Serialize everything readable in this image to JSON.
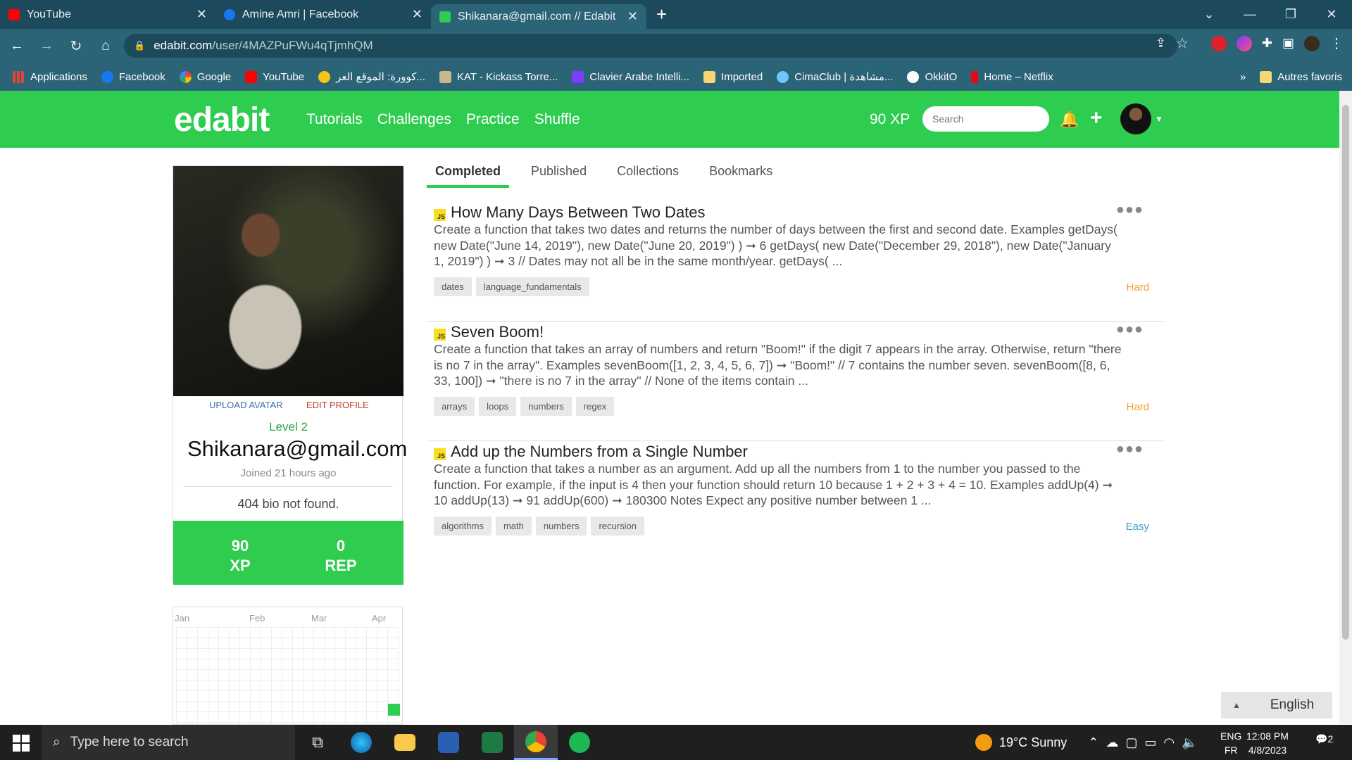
{
  "browser": {
    "tabs": [
      {
        "title": "YouTube",
        "icon": "youtube-icon",
        "color": "#ff0000"
      },
      {
        "title": "Amine Amri | Facebook",
        "icon": "facebook-icon",
        "color": "#1877f2"
      },
      {
        "title": "Shikanara@gmail.com // Edabit",
        "icon": "edabit-icon",
        "color": "#2ecc4f"
      }
    ],
    "url_host": "edabit.com",
    "url_path": "/user/4MAZPuFWu4qTjmhQM",
    "bookmarks": [
      {
        "label": "Applications",
        "color": "#4285f4"
      },
      {
        "label": "Facebook",
        "color": "#1877f2"
      },
      {
        "label": "Google",
        "color": "#ffffff"
      },
      {
        "label": "YouTube",
        "color": "#ff0000"
      },
      {
        "label": "كوورة: الموقع العر...",
        "color": "#f5c518"
      },
      {
        "label": "KAT - Kickass Torre...",
        "color": "#c8b98a"
      },
      {
        "label": "Clavier Arabe Intelli...",
        "color": "#7d3cff"
      },
      {
        "label": "Imported",
        "color": "#f7d774"
      },
      {
        "label": "CimaClub | مشاهدة...",
        "color": "#6ec6ff"
      },
      {
        "label": "OkkitO",
        "color": "#ffffff"
      },
      {
        "label": "Home – Netflix",
        "color": "#e50914"
      }
    ],
    "bookmarks_more": "»",
    "other_bookmarks": "Autres favoris"
  },
  "site": {
    "logo": "edabit",
    "nav": [
      "Tutorials",
      "Challenges",
      "Practice",
      "Shuffle"
    ],
    "xp": "90 XP",
    "search_placeholder": "Search",
    "brand_color": "#2ecc4f"
  },
  "profile": {
    "upload_avatar": "UPLOAD AVATAR",
    "edit_profile": "EDIT PROFILE",
    "level": "Level 2",
    "email": "Shikanara@gmail.com",
    "joined": "Joined 21 hours ago",
    "bio": "404 bio not found.",
    "xp_value": "90",
    "xp_label": "XP",
    "rep_value": "0",
    "rep_label": "REP"
  },
  "calendar": {
    "months": [
      "Jan",
      "Feb",
      "Mar",
      "Apr"
    ]
  },
  "content_tabs": [
    "Completed",
    "Published",
    "Collections",
    "Bookmarks"
  ],
  "challenges": [
    {
      "lang": "JS",
      "title": "How Many Days Between Two Dates",
      "description": "Create a function that takes two dates and returns the number of days between the first and second date. Examples getDays( new Date(\"June 14, 2019\"), new Date(\"June 20, 2019\") ) ➞ 6 getDays( new Date(\"December 29, 2018\"), new Date(\"January 1, 2019\") ) ➞ 3 // Dates may not all be in the same month/year. getDays( ...",
      "tags": [
        "dates",
        "language_fundamentals"
      ],
      "difficulty": "Hard",
      "difficulty_color": "#f0a030"
    },
    {
      "lang": "JS",
      "title": "Seven Boom!",
      "description": "Create a function that takes an array of numbers and return \"Boom!\" if the digit 7 appears in the array. Otherwise, return \"there is no 7 in the array\". Examples sevenBoom([1, 2, 3, 4, 5, 6, 7]) ➞ \"Boom!\" // 7 contains the number seven. sevenBoom([8, 6, 33, 100]) ➞ \"there is no 7 in the array\" // None of the items contain ...",
      "tags": [
        "arrays",
        "loops",
        "numbers",
        "regex"
      ],
      "difficulty": "Hard",
      "difficulty_color": "#f0a030"
    },
    {
      "lang": "JS",
      "title": "Add up the Numbers from a Single Number",
      "description": "Create a function that takes a number as an argument. Add up all the numbers from 1 to the number you passed to the function. For example, if the input is 4 then your function should return 10 because 1 + 2 + 3 + 4 = 10. Examples addUp(4) ➞ 10 addUp(13) ➞ 91 addUp(600) ➞ 180300 Notes Expect any positive number between 1 ...",
      "tags": [
        "algorithms",
        "math",
        "numbers",
        "recursion"
      ],
      "difficulty": "Easy",
      "difficulty_color": "#3aa0c8"
    }
  ],
  "language_selector": "English",
  "taskbar": {
    "search_placeholder": "Type here to search",
    "weather": "19°C  Sunny",
    "lang_top": "ENG",
    "lang_bottom": "FR",
    "time": "12:08 PM",
    "date": "4/8/2023",
    "notifications": "2"
  }
}
